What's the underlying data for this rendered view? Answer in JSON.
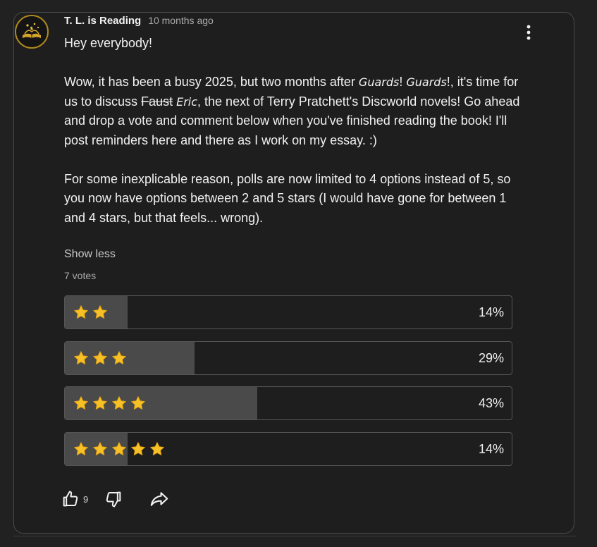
{
  "comment": {
    "author": "T. L. is Reading",
    "timestamp": "10 months ago",
    "avatar_icon": "book-stars-icon",
    "menu_icon": "more-vert-icon",
    "body": {
      "greeting": "Hey everybody!",
      "p2_a": "Wow, it has been a busy 2025, but two months after ",
      "p2_guards1": "Guards",
      "p2_excl1": "! ",
      "p2_guards2": "Guards",
      "p2_b": "!, it's time for us to discuss ",
      "p2_strike": "Faust",
      "p2_eric": "Eric",
      "p2_c": ", the next of Terry Pratchett's Discworld novels! Go ahead and drop a vote and comment below when you've finished reading the book! I'll post reminders here and there as I work on my essay. :)",
      "p3": "For some inexplicable reason, polls are now limited to 4 options instead of 5, so you now have options between 2 and 5 stars (I would have gone for between 1 and 4 stars, but that feels... wrong)."
    },
    "show_less": "Show less",
    "votes": "7 votes"
  },
  "poll": {
    "options": [
      {
        "stars": 2,
        "percent_value": 14,
        "percent": "14%"
      },
      {
        "stars": 3,
        "percent_value": 29,
        "percent": "29%"
      },
      {
        "stars": 4,
        "percent_value": 43,
        "percent": "43%"
      },
      {
        "stars": 5,
        "percent_value": 14,
        "percent": "14%"
      }
    ],
    "star_icon": "star-icon",
    "fill_color": "#4a4a4a",
    "star_color": "#f6c026"
  },
  "actions": {
    "like_icon": "thumbs-up-icon",
    "like_count": "9",
    "dislike_icon": "thumbs-down-icon",
    "share_icon": "share-icon"
  }
}
